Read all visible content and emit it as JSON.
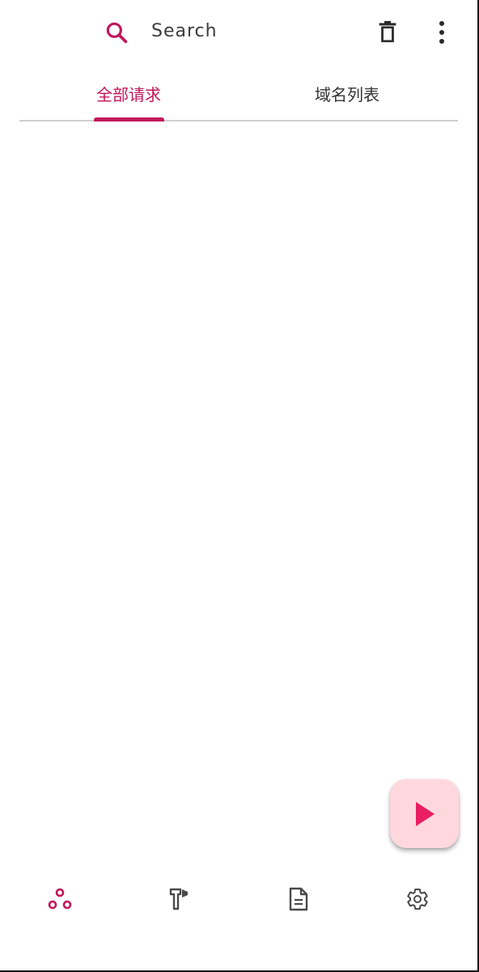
{
  "toolbar": {
    "search_label": "Search",
    "search_icon": "search-icon",
    "delete_icon": "trash-icon",
    "more_icon": "more-vert-icon"
  },
  "tabs": [
    {
      "label": "全部请求",
      "selected": true
    },
    {
      "label": "域名列表",
      "selected": false
    }
  ],
  "fab": {
    "icon": "play-icon"
  },
  "bottom_nav": {
    "items": [
      {
        "icon": "connections-icon",
        "selected": true
      },
      {
        "icon": "tools-icon",
        "selected": false
      },
      {
        "icon": "document-icon",
        "selected": false
      },
      {
        "icon": "settings-icon",
        "selected": false
      }
    ]
  },
  "colors": {
    "accent": "#c2185b",
    "fab_background": "#ffd8de",
    "fab_icon": "#e91e63",
    "icon_default": "#4a4a4a",
    "divider": "#cfcfcf"
  }
}
